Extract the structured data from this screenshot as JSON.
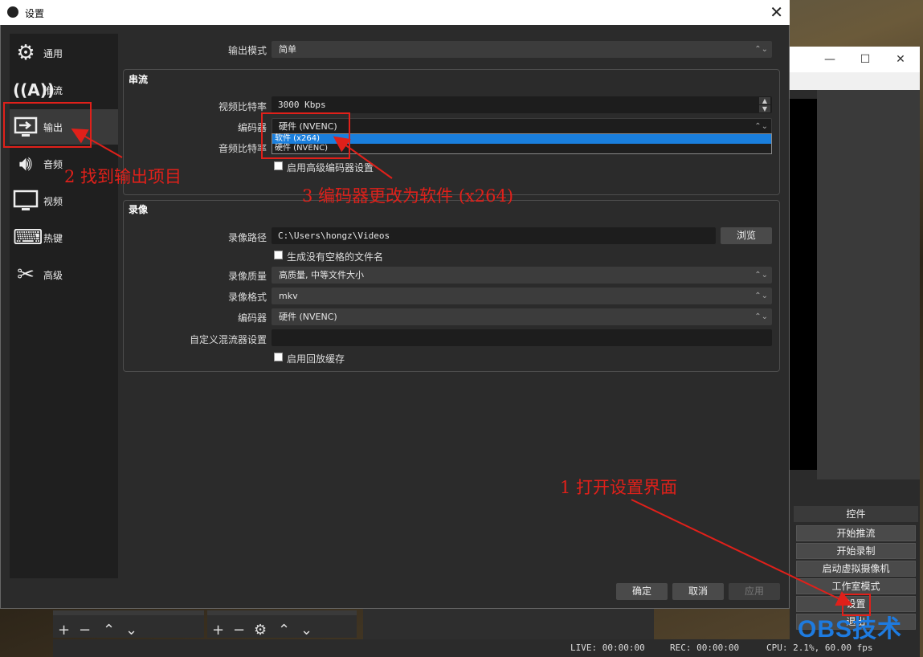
{
  "dialog": {
    "title": "设置"
  },
  "sidebar": {
    "items": [
      {
        "label": "通用",
        "icon": "gear-icon"
      },
      {
        "label": "推流",
        "icon": "broadcast-icon"
      },
      {
        "label": "输出",
        "icon": "output-icon"
      },
      {
        "label": "音频",
        "icon": "speaker-icon"
      },
      {
        "label": "视频",
        "icon": "monitor-icon"
      },
      {
        "label": "热键",
        "icon": "keyboard-icon"
      },
      {
        "label": "高级",
        "icon": "tools-icon"
      }
    ],
    "selected": "输出"
  },
  "output_mode": {
    "label": "输出模式",
    "value": "简单"
  },
  "streaming": {
    "title": "串流",
    "video_bitrate_label": "视频比特率",
    "video_bitrate_value": "3000 Kbps",
    "encoder_label": "编码器",
    "encoder_value": "硬件 (NVENC)",
    "audio_bitrate_label": "音频比特率",
    "advanced_checkbox_label": "启用高级编码器设置",
    "encoder_options": [
      "软件 (x264)",
      "硬件 (NVENC)"
    ]
  },
  "recording": {
    "title": "录像",
    "path_label": "录像路径",
    "path_value": "C:\\Users\\hongz\\Videos",
    "browse_label": "浏览",
    "no_space_label": "生成没有空格的文件名",
    "quality_label": "录像质量",
    "quality_value": "高质量, 中等文件大小",
    "format_label": "录像格式",
    "format_value": "mkv",
    "encoder_label": "编码器",
    "encoder_value": "硬件 (NVENC)",
    "muxer_label": "自定义混流器设置",
    "muxer_value": "",
    "replay_label": "启用回放缓存"
  },
  "footer": {
    "ok": "确定",
    "cancel": "取消",
    "apply": "应用"
  },
  "annotations": {
    "step1": "1 打开设置界面",
    "step2": "2 找到输出项目",
    "step3": "3 编码器更改为软件 (x264)"
  },
  "controls": {
    "title": "控件",
    "buttons": [
      "开始推流",
      "开始录制",
      "启动虚拟摄像机",
      "工作室模式",
      "设置",
      "退出"
    ]
  },
  "status": {
    "live": "LIVE: 00:00:00",
    "rec": "REC: 00:00:00",
    "cpu": "CPU: 2.1%, 60.00 fps"
  },
  "watermark": "OBS技术",
  "colors": {
    "accent": "#1a7fdd",
    "annotation": "#e0201a",
    "dialog_bg": "#2b2b2b"
  }
}
